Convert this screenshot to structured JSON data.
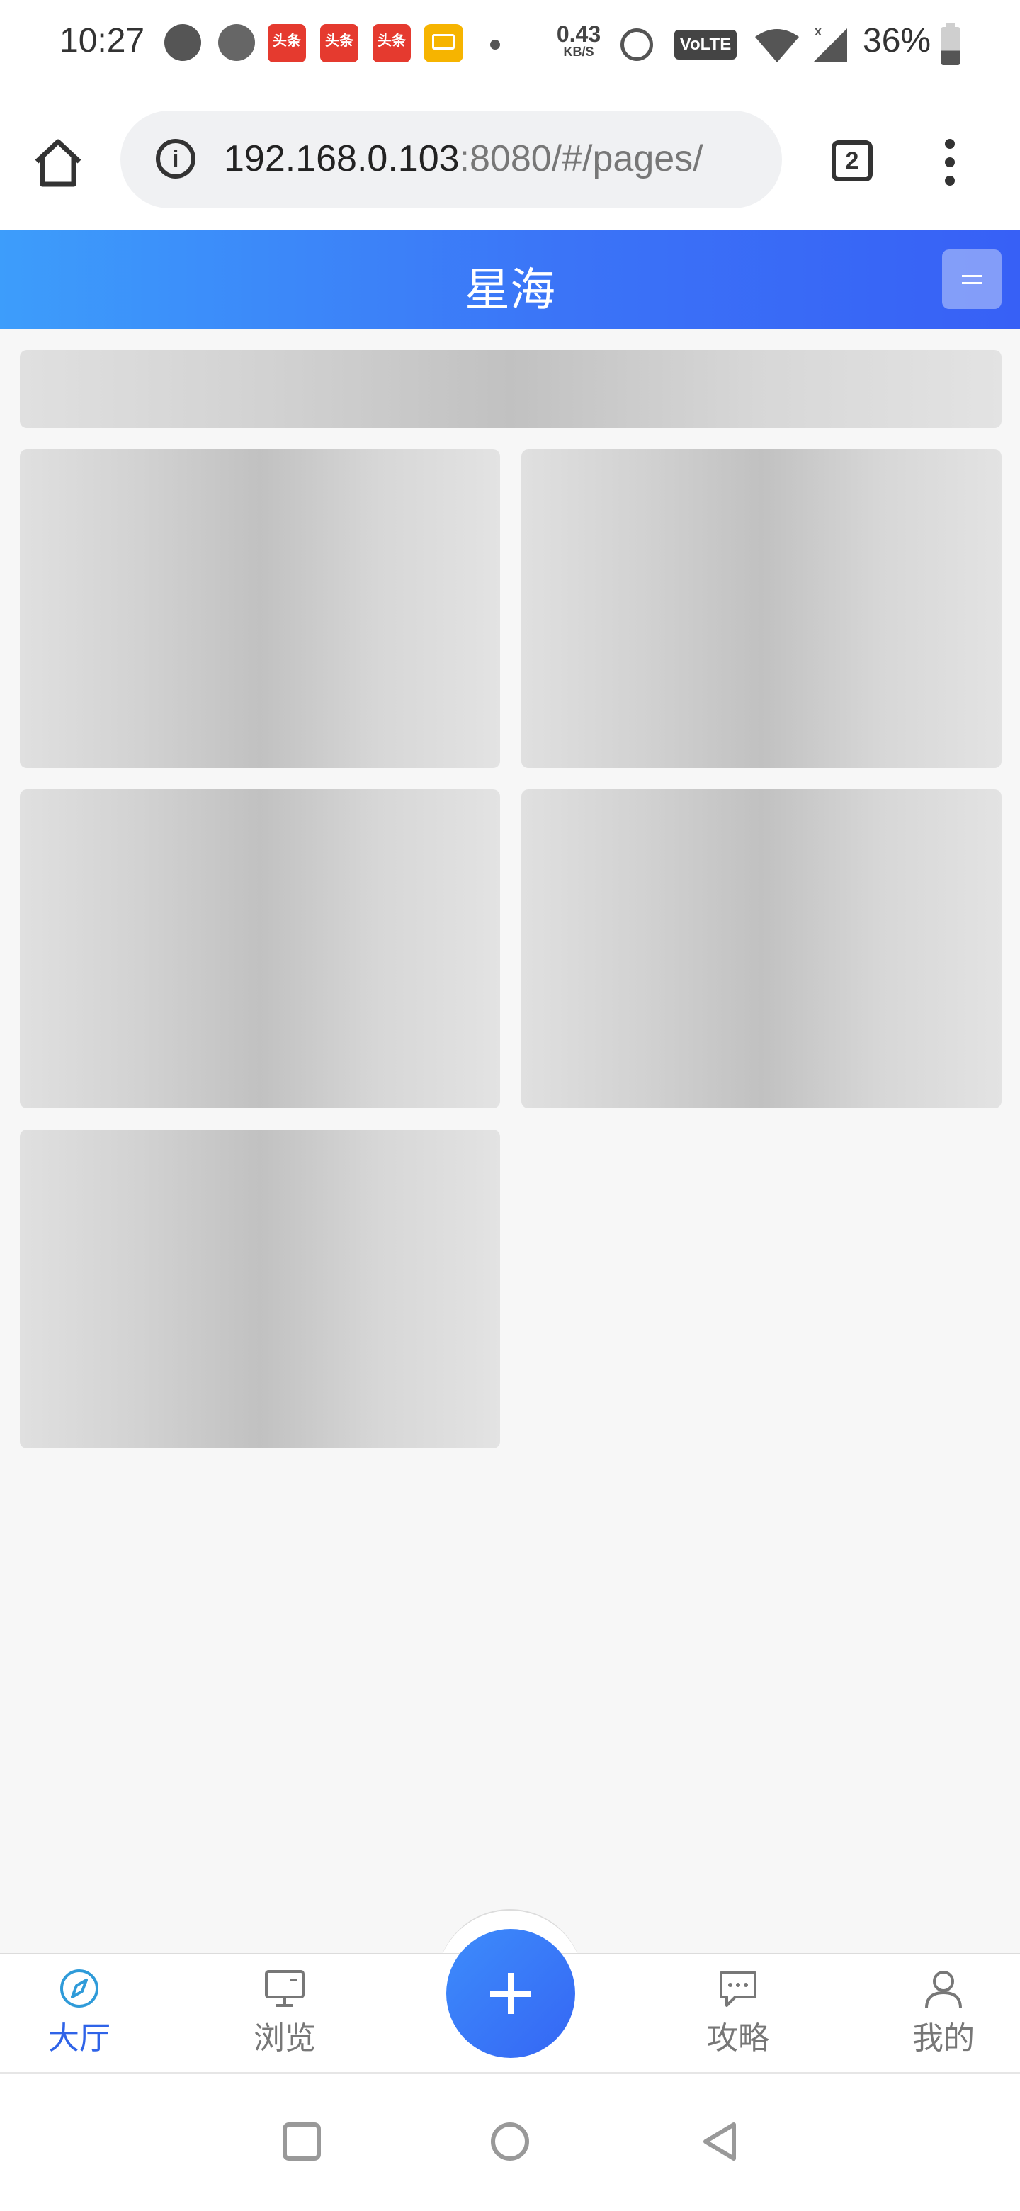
{
  "status_bar": {
    "time": "10:27",
    "news_label": "头条",
    "speed_value": "0.43",
    "speed_unit": "KB/S",
    "volte": "VoLTE",
    "battery": "36%"
  },
  "browser": {
    "url_host": "192.168.0.103",
    "url_rest": ":8080/#/pages/",
    "tab_count": "2"
  },
  "header": {
    "title": "星海",
    "menu_icon": "≡"
  },
  "skeleton": {
    "cards": 5
  },
  "bottom_nav": {
    "items": [
      {
        "label": "大厅",
        "icon": "compass-icon",
        "active": true
      },
      {
        "label": "浏览",
        "icon": "monitor-icon",
        "active": false
      },
      {
        "label": "攻略",
        "icon": "chat-icon",
        "active": false
      },
      {
        "label": "我的",
        "icon": "person-icon",
        "active": false
      }
    ],
    "fab_icon": "plus-icon"
  },
  "colors": {
    "accent": "#3b74f7",
    "header_start": "#3d9dfb",
    "active_tab": "#2f63e8",
    "skeleton": "#c1c1c1"
  }
}
